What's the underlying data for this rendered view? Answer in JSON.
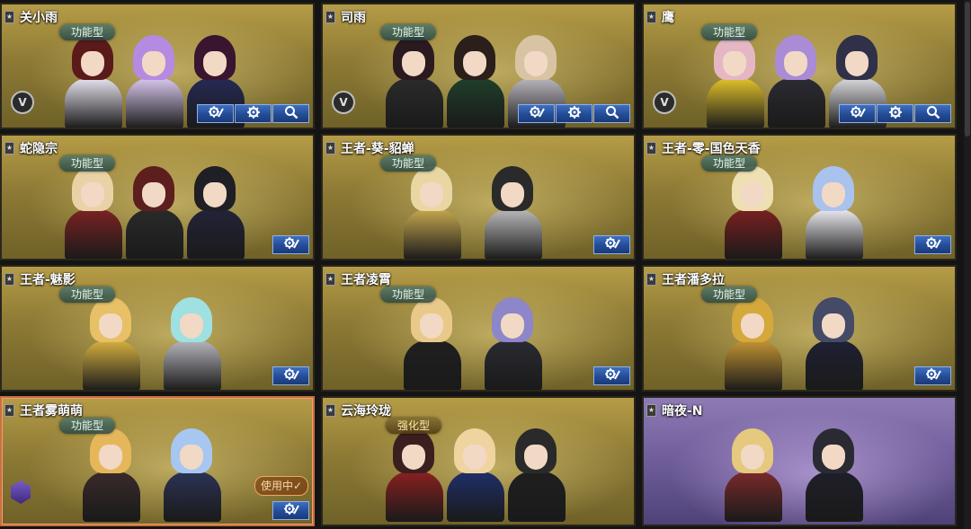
{
  "cards": [
    {
      "name": "关小雨",
      "type": "功能型",
      "badge": "v",
      "buttons": [
        "modify",
        "settings",
        "search"
      ],
      "chars": [
        {
          "hair": "#5a1a1a",
          "body": "#e7e2ef"
        },
        {
          "hair": "#b48be0",
          "body": "#d9c7ef"
        },
        {
          "hair": "#3a1530",
          "body": "#252a55"
        }
      ]
    },
    {
      "name": "司雨",
      "type": "功能型",
      "badge": "v",
      "buttons": [
        "modify",
        "settings",
        "search"
      ],
      "chars": [
        {
          "hair": "#2a1a20",
          "body": "#2b2b2b"
        },
        {
          "hair": "#2a1f1a",
          "body": "#1f3f2a"
        },
        {
          "hair": "#d8c4a4",
          "body": "#b9b6bd"
        }
      ]
    },
    {
      "name": "鹰",
      "type": "功能型",
      "badge": "v",
      "buttons": [
        "modify",
        "settings",
        "search"
      ],
      "chars": [
        {
          "hair": "#e5b7c5",
          "body": "#e2c22a"
        },
        {
          "hair": "#a98bd6",
          "body": "#2b2b33"
        },
        {
          "hair": "#303048",
          "body": "#d9d9dd"
        }
      ]
    },
    {
      "name": "蛇隐宗",
      "type": "功能型",
      "badge": "",
      "buttons": [
        "modify"
      ],
      "chars": [
        {
          "hair": "#e9d2a5",
          "body": "#7b2222"
        },
        {
          "hair": "#5d1e1e",
          "body": "#2a2a2a"
        },
        {
          "hair": "#1f1f25",
          "body": "#23233a"
        }
      ]
    },
    {
      "name": "王者-葵-貂蝉",
      "type": "功能型",
      "badge": "",
      "buttons": [
        "modify"
      ],
      "chars": [
        {
          "hair": "#e8d7a2",
          "body": "#c6a74f"
        },
        {
          "hair": "#2a2a2a",
          "body": "#b9b9b9"
        }
      ]
    },
    {
      "name": "王者-零-国色天香",
      "type": "功能型",
      "badge": "",
      "buttons": [
        "modify"
      ],
      "chars": [
        {
          "hair": "#efe0b4",
          "body": "#7a2020"
        },
        {
          "hair": "#a9c2ee",
          "body": "#e9e9ef"
        }
      ]
    },
    {
      "name": "王者-魅影",
      "type": "功能型",
      "badge": "",
      "buttons": [
        "modify"
      ],
      "chars": [
        {
          "hair": "#e8c065",
          "body": "#d6b040"
        },
        {
          "hair": "#9fe0e0",
          "body": "#b5b5bd"
        }
      ]
    },
    {
      "name": "王者凌霄",
      "type": "功能型",
      "badge": "",
      "buttons": [
        "modify"
      ],
      "chars": [
        {
          "hair": "#e9c98a",
          "body": "#1f1f1f"
        },
        {
          "hair": "#8d86c8",
          "body": "#2a2a33"
        }
      ]
    },
    {
      "name": "王者潘多拉",
      "type": "功能型",
      "badge": "",
      "buttons": [
        "modify"
      ],
      "chars": [
        {
          "hair": "#d5a83c",
          "body": "#c29333"
        },
        {
          "hair": "#454a66",
          "body": "#1f2033"
        }
      ]
    },
    {
      "name": "王者雾萌萌",
      "type": "功能型",
      "badge": "gem",
      "in_use": "使用中✓",
      "selected": true,
      "buttons": [
        "modify"
      ],
      "chars": [
        {
          "hair": "#e6b75a",
          "body": "#3a2a2a"
        },
        {
          "hair": "#a7c7f0",
          "body": "#2b3355"
        }
      ]
    },
    {
      "name": "云海玲珑",
      "type": "强化型",
      "enhanced": true,
      "badge": "",
      "buttons": [],
      "chars": [
        {
          "hair": "#3a1f1f",
          "body": "#8a2020"
        },
        {
          "hair": "#efd4a0",
          "body": "#1f2f6a"
        },
        {
          "hair": "#2a2a2a",
          "body": "#1f1f1f"
        }
      ]
    },
    {
      "name": "暗夜-N",
      "type": "",
      "purple": true,
      "badge": "",
      "buttons": [],
      "chars": [
        {
          "hair": "#e4c97f",
          "body": "#7a2a2a"
        },
        {
          "hair": "#2a2a33",
          "body": "#1f1f29"
        }
      ]
    }
  ],
  "button_icons": {
    "modify": "⚙̸",
    "settings": "⚙",
    "search": "🔍"
  }
}
